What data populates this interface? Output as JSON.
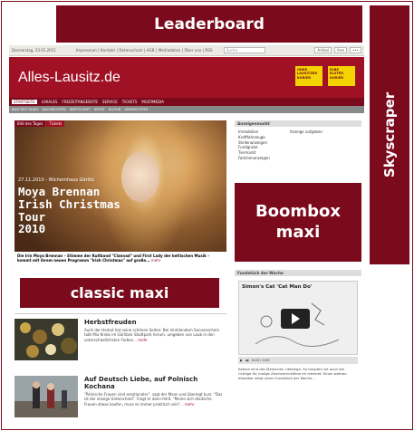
{
  "ads": {
    "leaderboard": "Leaderboard",
    "skyscraper": "Skyscraper",
    "boombox_line1": "Boombox",
    "boombox_line2": "maxi",
    "classic_maxi": "classic maxi"
  },
  "topbar": {
    "date": "Donnerstag, 23.01.2011",
    "links": "Impressum | Kontakt | Datenschutz | AGB | Mediadaten | Über uns | RSS",
    "search_placeholder": "Suche",
    "buttons": [
      "Artikel",
      "Ihre",
      "•••"
    ]
  },
  "header": {
    "logo": "Alles-Lausitz.de",
    "badge1": "ODER LAUSITZER KURIER",
    "badge2": "ELBE ELSTER KURIER"
  },
  "nav": {
    "items": [
      "STARTSEITE",
      "LOKALES",
      "FREIZEITANGEBOTE",
      "SERVICE",
      "TICKETS",
      "MULTIMEDIA"
    ]
  },
  "subnav": {
    "items": [
      "BILD DES TAGES",
      "NACHRICHTEN",
      "WIRTSCHAFT",
      "SPORT",
      "KULTUR",
      "VERMISCHTES"
    ]
  },
  "feature": {
    "tabs": [
      "Bild des Tages",
      "Tickets"
    ],
    "date": "27.11.2010 - Wichernhaus Görlitz",
    "headline_line1": "Moya Brennan",
    "headline_line2": "Irish Christmas Tour",
    "headline_line3": "2010",
    "caption": "Die Irin Moya Brennan – Stimme der Kultband \"Clannad\" und First Lady der keltischen Musik – kommt mit ihrem neuen Programm \"Irish Christmas\" auf große...",
    "more": "mehr"
  },
  "classified": {
    "title": "Anzeigenmarkt",
    "col1": [
      "Immobilien",
      "Kraftfahrzeuge",
      "Stellenanzeigen",
      "Fundgrube",
      "Tiermarkt",
      "Familienanzeigen"
    ],
    "col2": [
      "Anzeige aufgeben"
    ]
  },
  "stories": [
    {
      "title": "Herbstfreuden",
      "text": "Auch der Herbst hat seine schönen Seiten: Bei strahlendem Sonnenschein tobt Mia Krebs im Görlitzer Stadtpark herum, umgeben von Laub in den unterschiedlichsten Farben...",
      "more": "mehr"
    },
    {
      "title": "Auf Deutsch Liebe, auf Polnisch Kochana",
      "text": "\"Polnische Frauen sind emotionaler\", sagt der Mann und überlegt kurz. \"Das ist der einzige Unterschied\". Fragt er dann fehlt. \"Meine sich deutsche Frauen etwas kaufen, muss es immer praktisch sein\"...",
      "more": "mehr"
    }
  ],
  "fundstueck": {
    "title": "Fundstück der Woche",
    "video_title": "Simon's Cat  'Cat Man Do'",
    "time": "0:00 / 0:00",
    "desc": "Katzen sind des Menschen Lieblinge. So haupten sie auch die richtige für lustige Zeichentrickfilme im Internet. Einen wahren Klassiker zeigt unser Fundstück der Woche..."
  }
}
